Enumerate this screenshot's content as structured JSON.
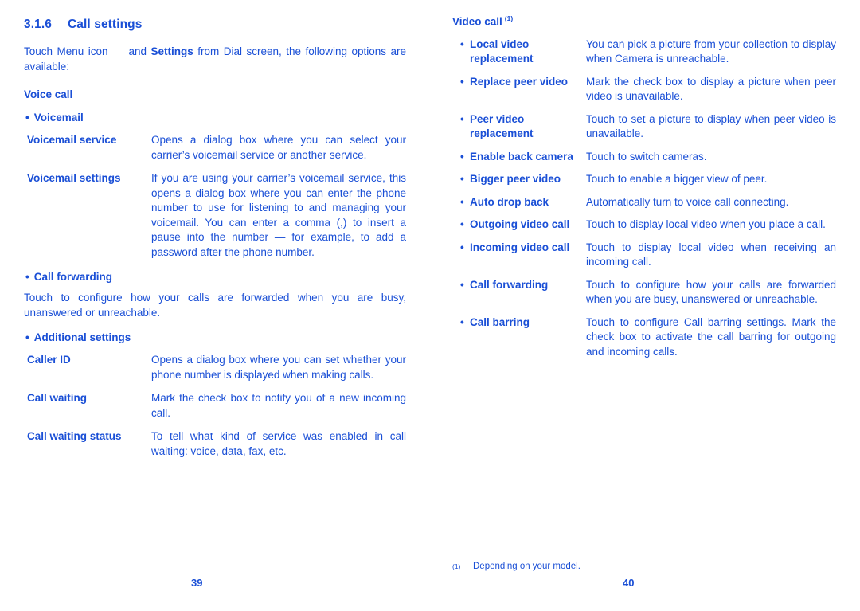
{
  "document": {
    "text_color": "#1a4fd6",
    "background_color": "#ffffff"
  },
  "left_page": {
    "page_number": "39",
    "section": {
      "number": "3.1.6",
      "title": "Call settings"
    },
    "intro": {
      "part1": "Touch Menu icon",
      "part2": "and ",
      "bold": "Settings",
      "part3": " from Dial screen, the following options are available:"
    },
    "voice_call_heading": "Voice call",
    "voicemail_bullet": "Voicemail",
    "voicemail_rows": [
      {
        "term": "Voicemail service",
        "desc": "Opens a dialog box where you can select your carrier’s voicemail service or another service."
      },
      {
        "term": "Voicemail settings",
        "desc": "If you are using your carrier’s voicemail service, this opens a dialog box where you can enter the phone number to use for listening to and managing your voicemail. You can enter a comma (,) to insert a pause into the number — for example, to add a password after the phone number."
      }
    ],
    "call_forwarding_bullet": "Call forwarding",
    "call_forwarding_text": "Touch to configure how your calls are forwarded when you are busy, unanswered or unreachable.",
    "additional_settings_bullet": "Additional settings",
    "additional_rows": [
      {
        "term": "Caller ID",
        "desc": "Opens a dialog box where you can set whether your phone number is displayed when making calls."
      },
      {
        "term": "Call waiting",
        "desc": "Mark the check box to notify you of a new incoming call."
      },
      {
        "term": "Call waiting status",
        "desc": "To tell what kind of service was enabled in call waiting: voice, data, fax, etc."
      }
    ]
  },
  "right_page": {
    "page_number": "40",
    "video_call_heading": "Video call",
    "video_call_footnote_mark": "(1)",
    "video_rows": [
      {
        "term": "Local video replacement",
        "desc": "You can pick a picture from your collection to display when Camera is unreachable."
      },
      {
        "term": "Replace peer video",
        "desc": "Mark the check box to display a picture when peer video is unavailable."
      },
      {
        "term": "Peer video replacement",
        "desc": "Touch to set a picture to display when peer video is unavailable."
      },
      {
        "term": "Enable back camera",
        "desc": "Touch to switch cameras."
      },
      {
        "term": "Bigger peer video",
        "desc": "Touch to enable a bigger view of peer."
      },
      {
        "term": "Auto drop back",
        "desc": "Automatically turn to voice call connecting."
      },
      {
        "term": "Outgoing video call",
        "desc": "Touch to display local video when you place a call."
      },
      {
        "term": "Incoming video call",
        "desc": "Touch to display local video when receiving an incoming call."
      },
      {
        "term": "Call forwarding",
        "desc": "Touch to configure how your calls are forwarded when you are busy, unanswered or unreachable."
      },
      {
        "term": "Call barring",
        "desc": "Touch to configure Call barring settings. Mark the check box to activate the call barring for outgoing and incoming calls."
      }
    ],
    "footnote": {
      "mark": "(1)",
      "text": "Depending on your model."
    }
  },
  "glyphs": {
    "bullet": "•"
  }
}
